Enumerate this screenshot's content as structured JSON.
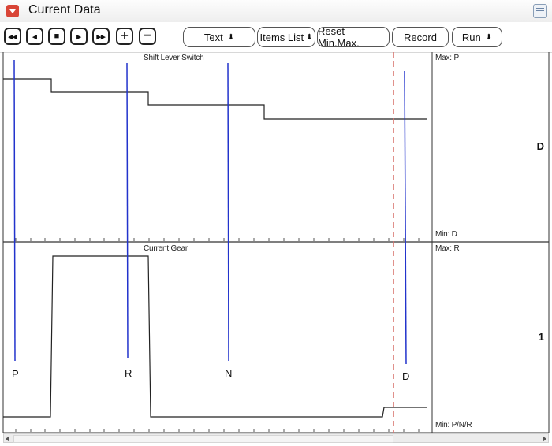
{
  "window": {
    "title": "Current Data"
  },
  "toolbar": {
    "buttons": [
      {
        "name": "rewind",
        "glyph": "◂◂"
      },
      {
        "name": "step-back",
        "glyph": "◂"
      },
      {
        "name": "stop",
        "glyph": "■"
      },
      {
        "name": "step-forward",
        "glyph": "▸"
      },
      {
        "name": "fast-forward",
        "glyph": "▸▸"
      },
      {
        "name": "zoom-in",
        "glyph": "+"
      },
      {
        "name": "zoom-out",
        "glyph": "−"
      }
    ],
    "view_select": "Text",
    "items_list": "Items List",
    "reset": "Reset Min.Max.",
    "record": "Record",
    "run_select": "Run"
  },
  "graphs": [
    {
      "title": "Shift Lever Switch",
      "max_label": "Max: P",
      "min_label": "Min: D",
      "current_value": "D"
    },
    {
      "title": "Current Gear",
      "max_label": "Max: R",
      "min_label": "Min: P/N/R",
      "current_value": "1"
    }
  ],
  "markers": [
    "P",
    "R",
    "N",
    "D"
  ],
  "colors": {
    "marker_line": "#2233cc",
    "cursor_line": "#d9766f",
    "trace": "#222222"
  }
}
